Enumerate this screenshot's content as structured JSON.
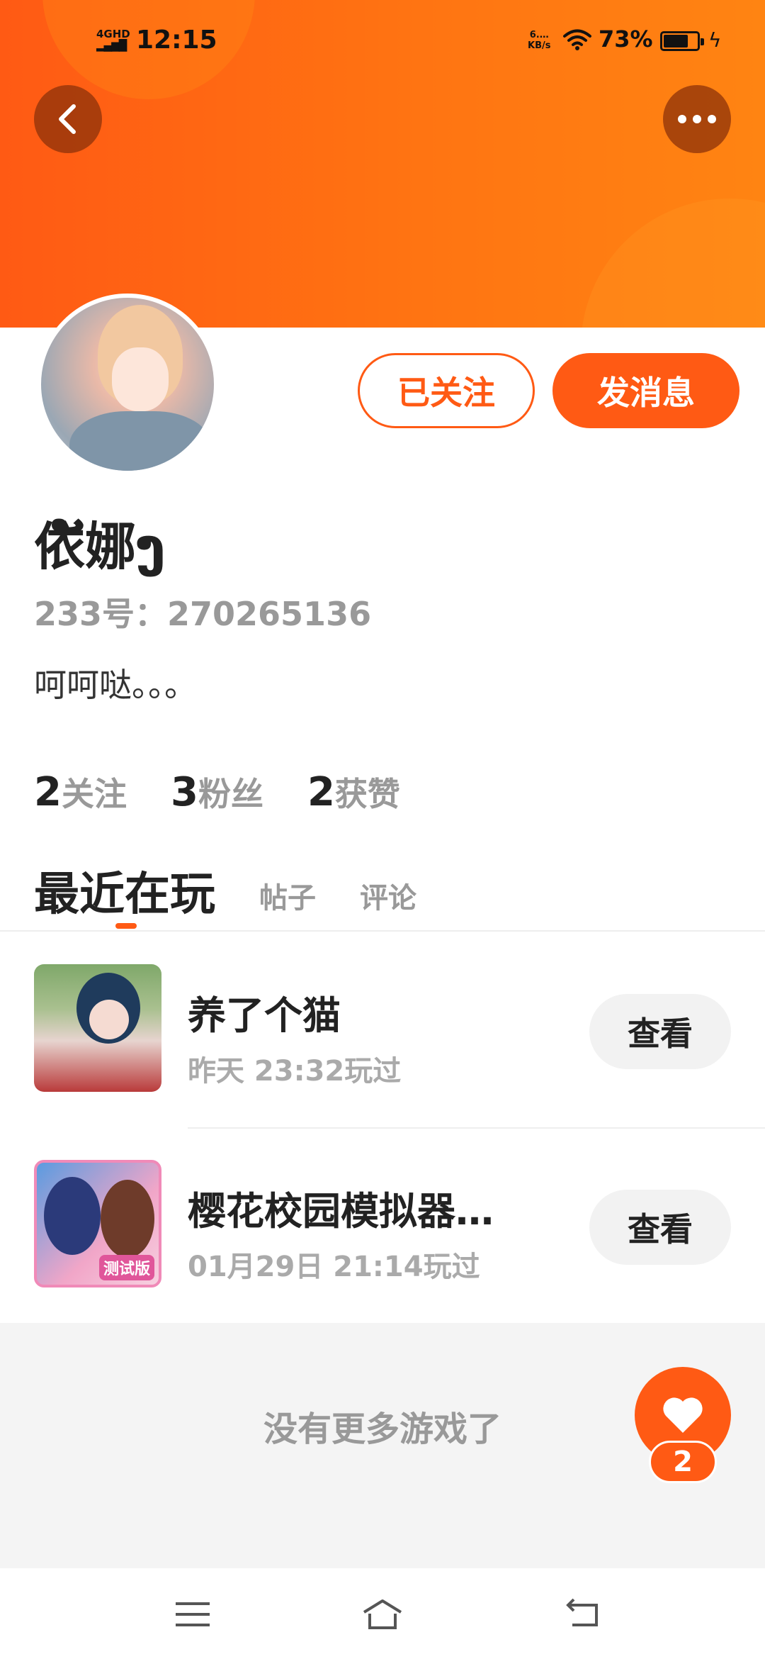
{
  "status_bar": {
    "network": "4GHD",
    "time": "12:15",
    "speed_value": "6.…",
    "speed_unit": "KB/s",
    "battery": "73%"
  },
  "profile": {
    "name": "依ັ娜ງ",
    "id": "233号：270265136",
    "bio": "呵呵哒。。。",
    "follow_label": "已关注",
    "message_label": "发消息"
  },
  "stats": [
    {
      "num": "2",
      "label": "关注"
    },
    {
      "num": "3",
      "label": "粉丝"
    },
    {
      "num": "2",
      "label": "获赞"
    }
  ],
  "tabs": [
    {
      "label": "最近在玩",
      "active": true
    },
    {
      "label": "帖子",
      "active": false
    },
    {
      "label": "评论",
      "active": false
    }
  ],
  "games": [
    {
      "title": "养了个猫",
      "time": "昨天 23:32玩过",
      "button": "查看"
    },
    {
      "title": "樱花校园模拟器…",
      "time": "01月29日 21:14玩过",
      "button": "查看",
      "badge": "测试版"
    }
  ],
  "no_more": "没有更多游戏了",
  "like_count": "2",
  "colors": {
    "accent": "#ff5a14",
    "header_gradient_end": "#ff8412",
    "muted_text": "#999999",
    "button_gray": "#f2f2f2"
  }
}
